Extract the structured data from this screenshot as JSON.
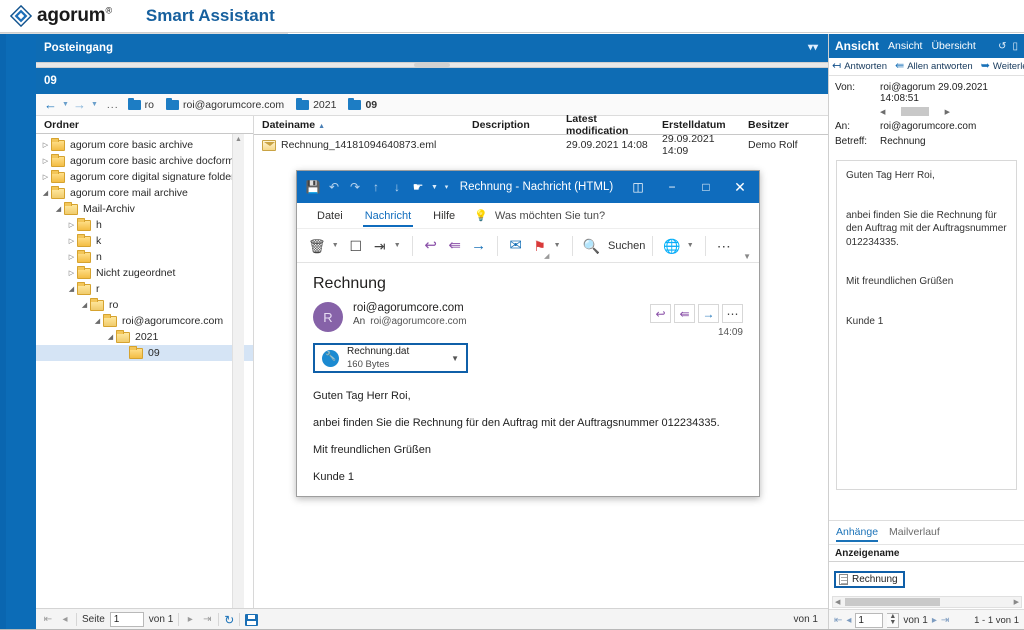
{
  "brand": {
    "name": "agorum",
    "registered": "®",
    "app_title": "Smart Assistant",
    "logo_icon": "agorum-diamond-logo"
  },
  "center": {
    "inbox_header": "Posteingang",
    "folder_header": "09",
    "collapse_icon": "chevron-double-down-icon",
    "breadcrumb": {
      "back_icon": "back-arrow-icon",
      "forward_icon": "forward-arrow-icon",
      "ellipsis": "...",
      "items": [
        {
          "label": "ro",
          "bold": false
        },
        {
          "label": "roi@agorumcore.com",
          "bold": false
        },
        {
          "label": "2021",
          "bold": false
        },
        {
          "label": "09",
          "bold": true
        }
      ]
    },
    "tree": {
      "header": "Ordner",
      "nodes": [
        {
          "label": "agorum core basic archive",
          "depth": 0,
          "state": "collapsed",
          "selected": false
        },
        {
          "label": "agorum core basic archive docform",
          "depth": 0,
          "state": "collapsed",
          "selected": false
        },
        {
          "label": "agorum core digital signature folder",
          "depth": 0,
          "state": "collapsed",
          "selected": false
        },
        {
          "label": "agorum core mail archive",
          "depth": 0,
          "state": "expanded",
          "selected": false
        },
        {
          "label": "Mail-Archiv",
          "depth": 1,
          "state": "expanded",
          "selected": false
        },
        {
          "label": "h",
          "depth": 2,
          "state": "collapsed",
          "selected": false
        },
        {
          "label": "k",
          "depth": 2,
          "state": "collapsed",
          "selected": false
        },
        {
          "label": "n",
          "depth": 2,
          "state": "collapsed",
          "selected": false
        },
        {
          "label": "Nicht zugeordnet",
          "depth": 2,
          "state": "collapsed",
          "selected": false
        },
        {
          "label": "r",
          "depth": 2,
          "state": "expanded",
          "selected": false
        },
        {
          "label": "ro",
          "depth": 3,
          "state": "expanded",
          "selected": false
        },
        {
          "label": "roi@agorumcore.com",
          "depth": 4,
          "state": "expanded",
          "selected": false
        },
        {
          "label": "2021",
          "depth": 5,
          "state": "expanded",
          "selected": false
        },
        {
          "label": "09",
          "depth": 6,
          "state": "leaf",
          "selected": true
        }
      ]
    },
    "filelist": {
      "columns": [
        "Dateiname",
        "Description",
        "Latest modification",
        "Erstelldatum",
        "Besitzer"
      ],
      "sort_column": "Dateiname",
      "sort_icon": "sort-ascending-icon",
      "rows": [
        {
          "icon": "eml-mail-icon",
          "name": "Rechnung_14181094640873.eml",
          "description": "",
          "latest_modification": "29.09.2021 14:08",
          "created": "29.09.2021 14:09",
          "owner": "Demo Rolf"
        }
      ]
    },
    "pager": {
      "first_icon": "first-page-icon",
      "prev_icon": "prev-page-icon",
      "page_label": "Seite",
      "page_value": "1",
      "of_label": "von 1",
      "next_icon": "next-page-icon",
      "last_icon": "last-page-icon",
      "refresh_icon": "refresh-icon",
      "save_icon": "save-icon",
      "right_label": "von 1"
    }
  },
  "outlook": {
    "window_title": "Rechnung  -  Nachricht (HTML)",
    "quick_access": [
      {
        "icon": "save-icon",
        "name": "save"
      },
      {
        "icon": "undo-icon",
        "name": "undo"
      },
      {
        "icon": "redo-icon",
        "name": "redo"
      },
      {
        "icon": "up-arrow-icon",
        "name": "previous-item"
      },
      {
        "icon": "down-arrow-icon",
        "name": "next-item"
      },
      {
        "icon": "touch-mode-icon",
        "name": "touch-mouse-mode"
      }
    ],
    "window_buttons": [
      {
        "icon": "ribbon-display-icon",
        "name": "ribbon-display-options"
      },
      {
        "icon": "minimize-icon",
        "name": "minimize"
      },
      {
        "icon": "maximize-icon",
        "name": "maximize"
      },
      {
        "icon": "close-icon",
        "name": "close"
      }
    ],
    "tabs": [
      {
        "label": "Datei",
        "active": false
      },
      {
        "label": "Nachricht",
        "active": true
      },
      {
        "label": "Hilfe",
        "active": false
      }
    ],
    "tell_me": "Was möchten Sie tun?",
    "tell_me_icon": "lightbulb-icon",
    "ribbon": [
      {
        "icon": "delete-trash-icon",
        "name": "delete",
        "caret": true
      },
      {
        "icon": "archive-icon",
        "name": "archive",
        "caret": false
      },
      {
        "icon": "move-to-icon",
        "name": "move-to",
        "caret": true
      },
      {
        "icon": "reply-icon",
        "name": "reply",
        "caret": false
      },
      {
        "icon": "reply-all-icon",
        "name": "reply-all",
        "caret": false
      },
      {
        "icon": "forward-icon",
        "name": "forward",
        "caret": false
      },
      {
        "icon": "quick-steps-icon",
        "name": "quick-steps",
        "caret": false
      },
      {
        "icon": "flag-follow-up-icon",
        "name": "follow-up",
        "caret": true
      },
      {
        "icon": "search-icon",
        "name": "search",
        "caret": false
      },
      {
        "icon": "translate-icon",
        "name": "translate",
        "caret": true
      },
      {
        "icon": "more-ellipsis-icon",
        "name": "more-commands",
        "caret": false
      }
    ],
    "search_label": "Suchen",
    "message": {
      "subject": "Rechnung",
      "avatar_initial": "R",
      "from": "roi@agorumcore.com",
      "to_label": "An",
      "to": "roi@agorumcore.com",
      "time": "14:09",
      "reply_buttons": [
        {
          "icon": "reply-icon",
          "name": "reply"
        },
        {
          "icon": "reply-all-icon",
          "name": "reply-all"
        },
        {
          "icon": "forward-icon",
          "name": "forward"
        },
        {
          "icon": "more-ellipsis-icon",
          "name": "more-actions"
        }
      ],
      "attachment": {
        "icon": "dat-file-icon",
        "name": "Rechnung.dat",
        "size": "160 Bytes",
        "caret_icon": "chevron-down-icon"
      },
      "body": [
        "Guten Tag Herr Roi,",
        "anbei finden Sie die Rechnung für den Auftrag mit der Auftragsnummer 012234335.",
        "Mit freundlichen Grüßen",
        "Kunde 1"
      ]
    }
  },
  "right_panel": {
    "header": {
      "title": "Ansicht",
      "item2": "Ansicht",
      "item3": "Übersicht",
      "icons": [
        {
          "icon": "refresh-icon",
          "name": "refresh"
        },
        {
          "icon": "window-icon",
          "name": "detach-window"
        }
      ]
    },
    "toolbar": [
      {
        "icon": "reply-icon",
        "label": "Antworten"
      },
      {
        "icon": "reply-all-icon",
        "label": "Allen antworten"
      },
      {
        "icon": "forward-icon",
        "label": "Weiterlei"
      }
    ],
    "fields": [
      {
        "label": "Von:",
        "value": "roi@agorum 29.09.2021 14:08:51"
      },
      {
        "label": "An:",
        "value": "roi@agorumcore.com"
      },
      {
        "label": "Betreff:",
        "value": "Rechnung"
      }
    ],
    "body": [
      "Guten Tag Herr Roi,",
      "anbei finden Sie die Rechnung für den Auftrag mit der Auftragsnummer 012234335.",
      "Mit freundlichen Grüßen",
      "Kunde 1"
    ],
    "tabs": [
      {
        "label": "Anhänge",
        "active": true
      },
      {
        "label": "Mailverlauf",
        "active": false
      }
    ],
    "grid": {
      "column": "Anzeigename",
      "rows": [
        {
          "icon": "document-icon",
          "name": "Rechnung"
        }
      ]
    },
    "pager": {
      "first_icon": "first-page-icon",
      "prev_icon": "prev-page-icon",
      "page_value": "1",
      "of_label": "von 1",
      "next_icon": "next-page-icon",
      "last_icon": "last-page-icon",
      "range_label": "1 - 1 von 1"
    }
  },
  "colors": {
    "brand_blue": "#0e6cb4",
    "accent_blue": "#1a72b8",
    "outlook_blue": "#0f6cbd",
    "highlight_border": "#0f5fa8",
    "selection": "#d5e4f5",
    "folder_yellow": "#f3bd45"
  }
}
